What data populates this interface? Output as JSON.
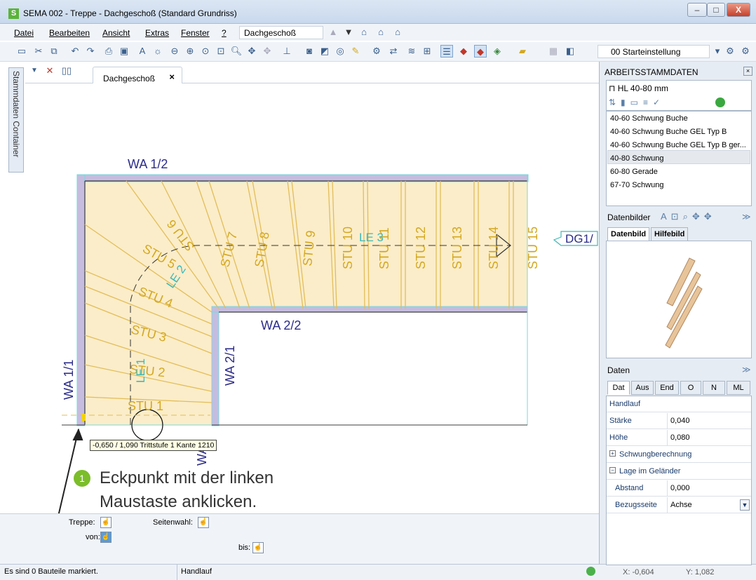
{
  "window": {
    "title": "SEMA  002 - Treppe  - Dachgeschoß (Standard Grundriss)",
    "logo": "S",
    "controls": [
      "–",
      "□",
      "X"
    ]
  },
  "menu": {
    "items": [
      "Datei",
      "Bearbeiten",
      "Ansicht",
      "Extras",
      "Fenster",
      "?"
    ],
    "floor": "Dachgeschoß"
  },
  "toolbar": {
    "preset": "00 Starteinstellung"
  },
  "side_tab": "Stammdaten Container",
  "document_tab": {
    "label": "Dachgeschoß",
    "close": "×"
  },
  "drawing": {
    "wall_labels": [
      "WA 1/2",
      "WA 2/2",
      "WA 1/1",
      "WA 2/1",
      "WA"
    ],
    "steps": [
      "STU 1",
      "STU 2",
      "STU 3",
      "STU 4",
      "STU 5",
      "STU 6",
      "STU 7",
      "STU 8",
      "STU 9",
      "STU 10",
      "STU 11",
      "STU 12",
      "STU 13",
      "STU 14",
      "STU 15"
    ],
    "walklines": [
      "LE 1",
      "LE 2",
      "LE 3"
    ],
    "exit_marker": "DG1/"
  },
  "tooltip": "-0,650 / 1,090 Trittstufe 1 Kante 1210",
  "callout": {
    "number": "1",
    "line1": "Eckpunkt mit der linken",
    "line2": "Maustaste anklicken."
  },
  "bottom_controls": {
    "treppe_label": "Treppe:",
    "seitenwahl_label": "Seitenwahl:",
    "von_label": "von:",
    "bis_label": "bis:"
  },
  "status": {
    "message": "Es sind 0 Bauteile markiert.",
    "mode": "Handlauf",
    "x_readout": "X: -0,604",
    "y_readout": "Y: 1,082"
  },
  "right_panel": {
    "header": "ARBEITSSTAMMDATEN",
    "group": "HL 40-80 mm",
    "list": [
      "40-60 Schwung Buche",
      "40-60 Schwung Buche GEL Typ B",
      "40-60 Schwung Buche GEL Typ B ger...",
      "40-80 Schwung",
      "60-80 Gerade",
      "67-70 Schwung"
    ],
    "selected_index": 3,
    "images_header": "Datenbilder",
    "image_tabs": [
      "Datenbild",
      "Hilfebild"
    ],
    "daten_header": "Daten",
    "daten_tabs": [
      "Dat",
      "Aus",
      "End",
      "O",
      "N",
      "ML"
    ],
    "props": {
      "section": "Handlauf",
      "staerke_label": "Stärke",
      "staerke_value": "0,040",
      "hoehe_label": "Höhe",
      "hoehe_value": "0,080",
      "schwung_label": "Schwungberechnung",
      "lage_label": "Lage im Geländer",
      "abstand_label": "Abstand",
      "abstand_value": "0,000",
      "bezug_label": "Bezugsseite",
      "bezug_value": "Achse"
    }
  },
  "colors": {
    "stair_fill": "#fbedc9",
    "step_line": "#e2bd5a",
    "wall": "#9a8fb8",
    "wall_text": "#2b2b8a",
    "step_text": "#d4a820",
    "walkline_text": "#3fb8b8",
    "callout": "#7bbd2a"
  }
}
